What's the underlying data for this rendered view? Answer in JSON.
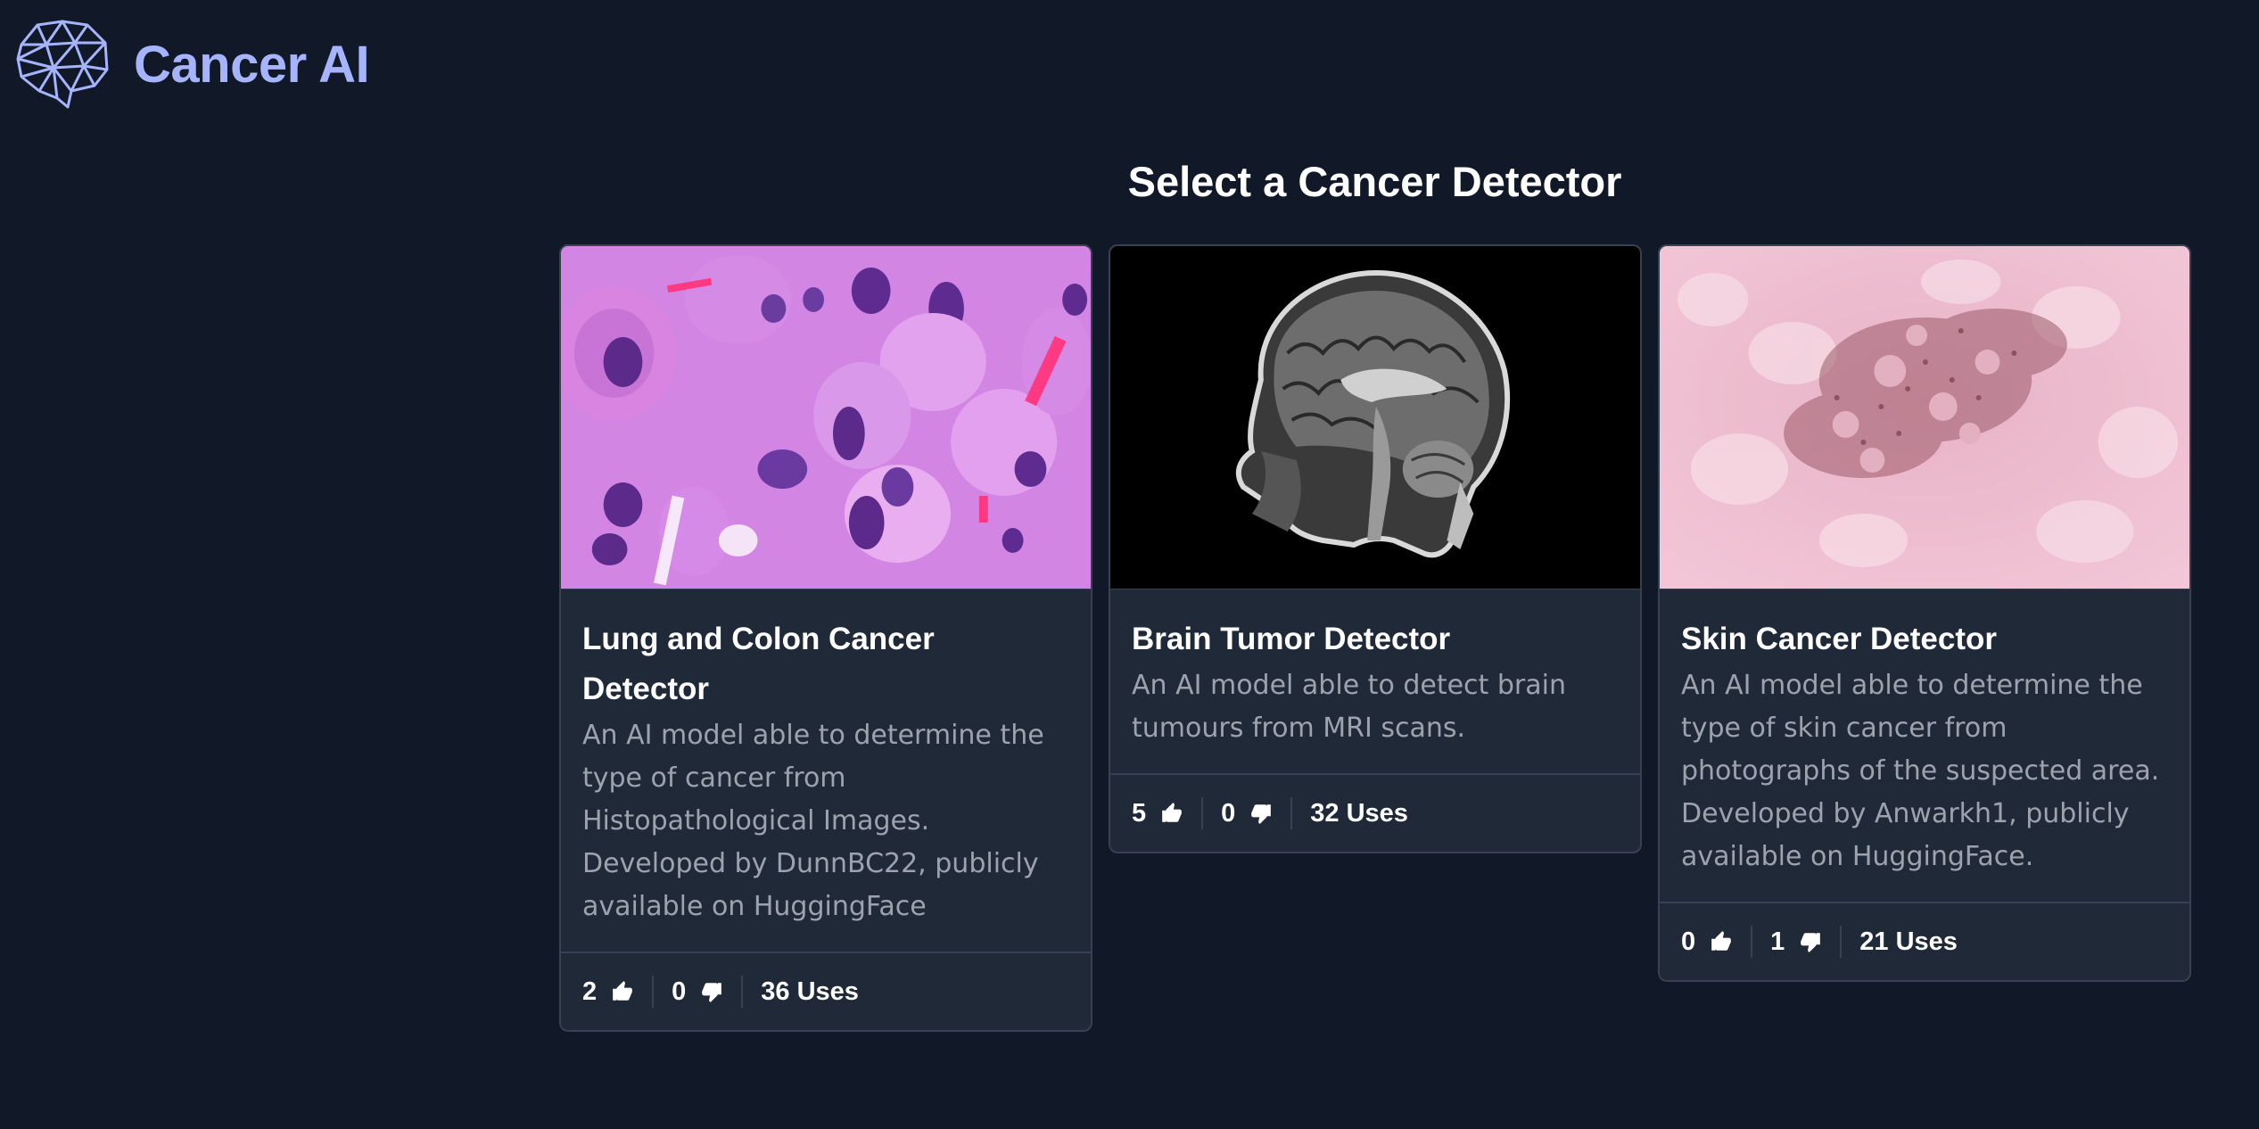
{
  "brand": {
    "name": "Cancer AI",
    "logo_icon": "brain-mesh-icon",
    "color": "#a5b4fc"
  },
  "page": {
    "title": "Select a Cancer Detector"
  },
  "cards": [
    {
      "title": "Lung and Colon Cancer Detector",
      "description": "An AI model able to determine the type of cancer from Histopathological Images. Developed by DunnBC22, publicly available on HuggingFace",
      "likes": "2",
      "dislikes": "0",
      "uses": "36 Uses"
    },
    {
      "title": "Brain Tumor Detector",
      "description": "An AI model able to detect brain tumours from MRI scans.",
      "likes": "5",
      "dislikes": "0",
      "uses": "32 Uses"
    },
    {
      "title": "Skin Cancer Detector",
      "description": "An AI model able to determine the type of skin cancer from photographs of the suspected area. Developed by Anwarkh1, publicly available on HuggingFace.",
      "likes": "0",
      "dislikes": "1",
      "uses": "21 Uses"
    }
  ],
  "icons": {
    "like": "thumbs-up-icon",
    "dislike": "thumbs-down-icon"
  },
  "colors": {
    "background": "#111827",
    "card": "#1f2937",
    "border": "#374151",
    "muted_text": "#9ca3af"
  }
}
